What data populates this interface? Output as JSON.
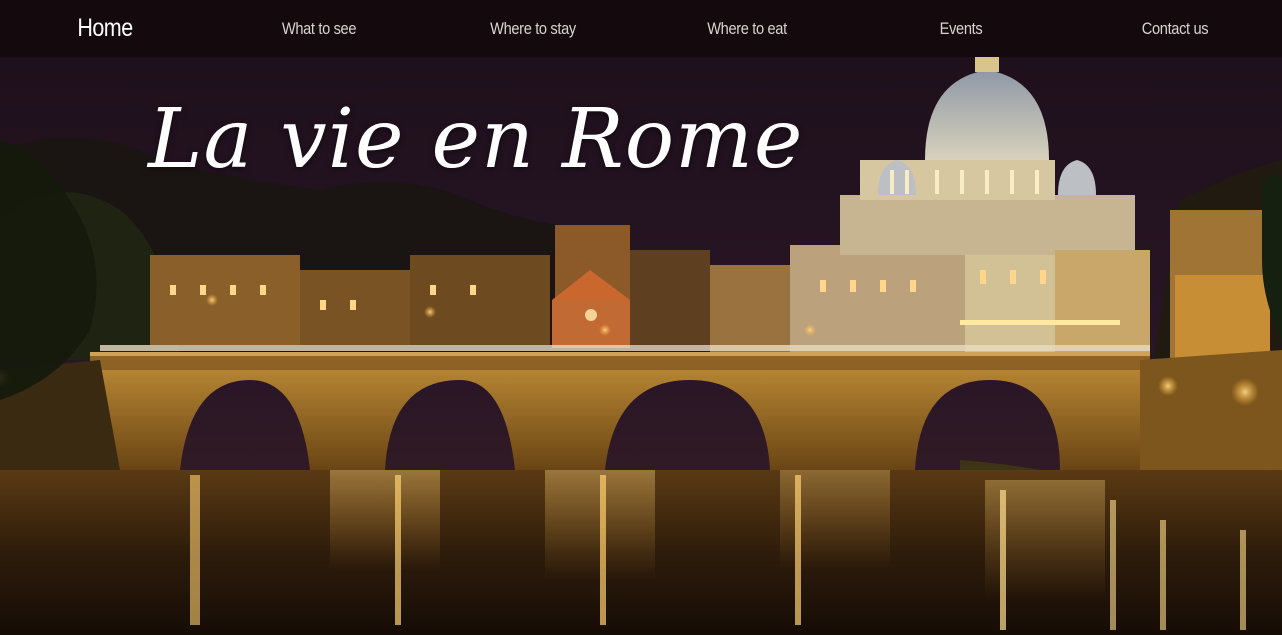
{
  "nav": {
    "home": "Home",
    "what_to_see": "What to see",
    "where_to_stay": "Where to stay",
    "where_to_eat": "Where to eat",
    "events": "Events",
    "contact_us": "Contact us"
  },
  "hero": {
    "headline": "La vie en Rome"
  },
  "colors": {
    "nav_background": "#140a0d",
    "night_sky": "#241420",
    "warm_light": "#e8a12a"
  }
}
